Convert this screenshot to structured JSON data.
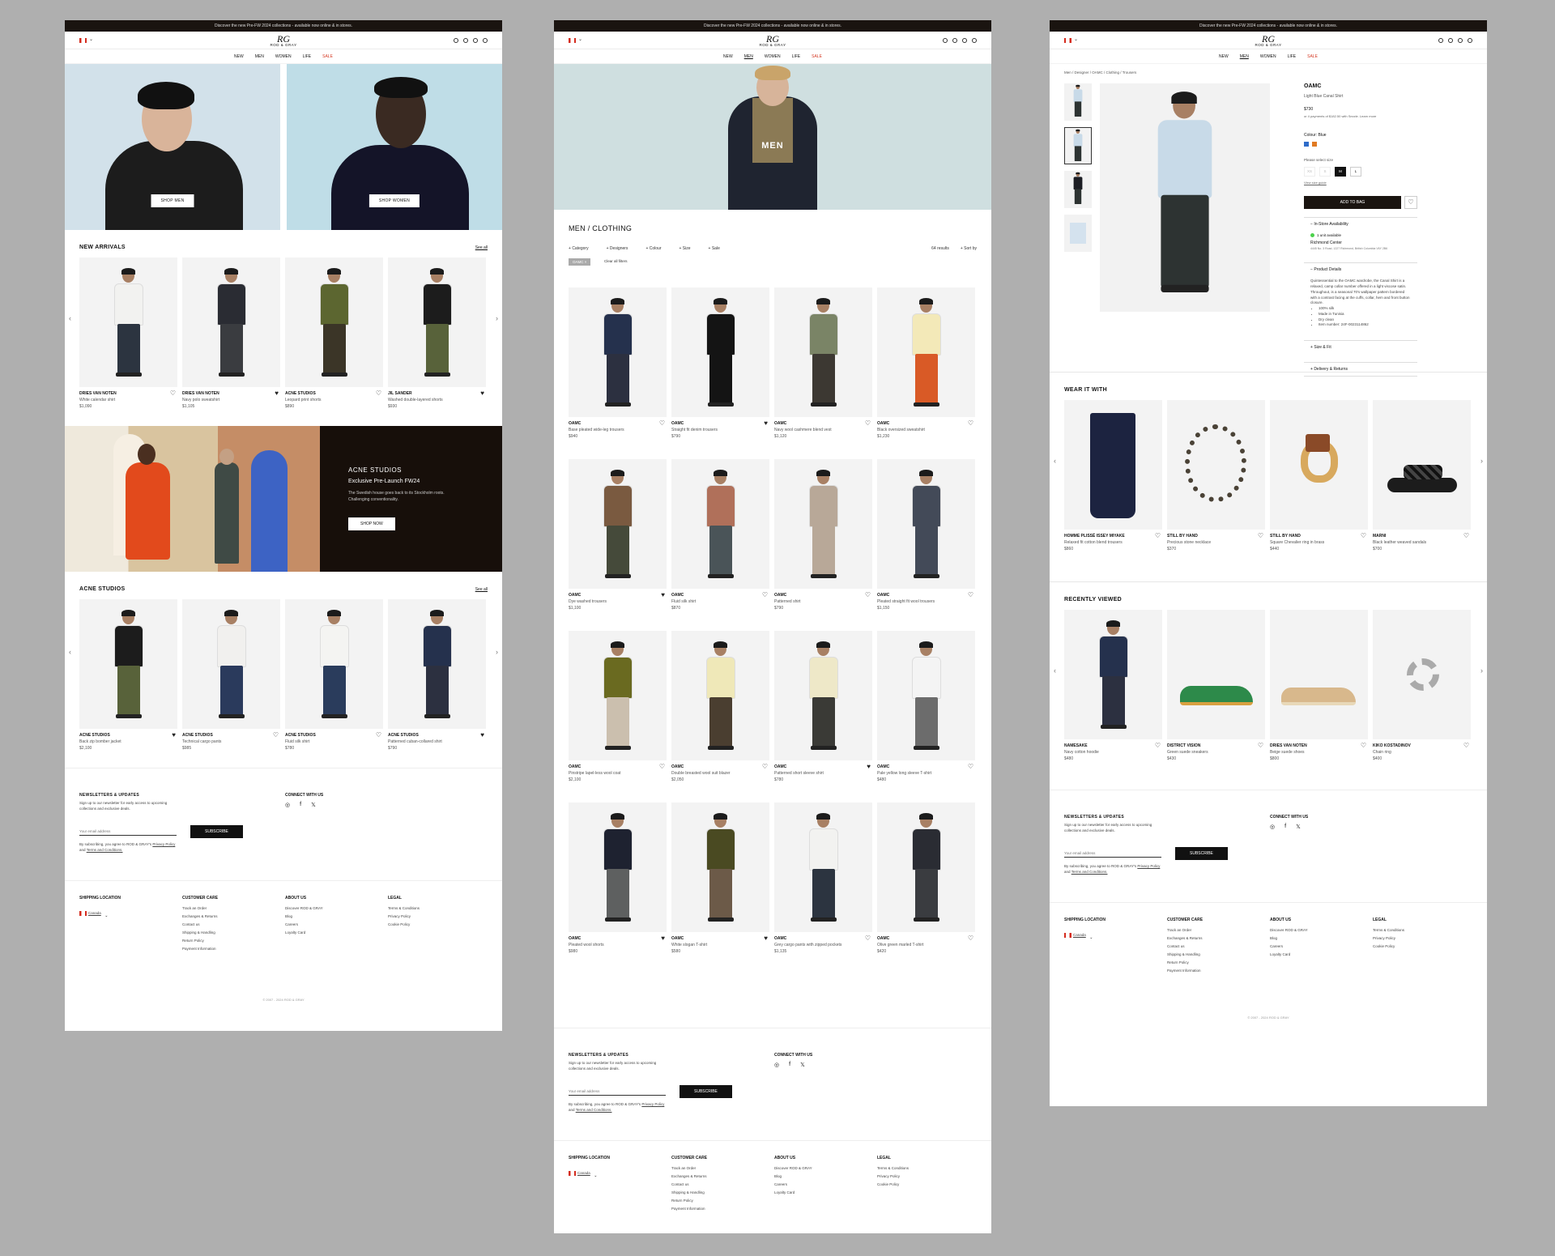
{
  "header": {
    "banner": "Discover the new Pre-FW 2024 collections - available now online & in stores.",
    "logo_mark": "RG",
    "logo_text": "ROD & GRAY",
    "nav": [
      "NEW",
      "MEN",
      "WOMEN",
      "LIFE",
      "SALE"
    ]
  },
  "home": {
    "hero": {
      "men_button": "SHOP MEN",
      "women_button": "SHOP WOMEN"
    },
    "new_arrivals": {
      "title": "NEW ARRIVALS",
      "see_all": "See all",
      "items": [
        {
          "brand": "DRIES VAN NOTEN",
          "desc": "White calendar shirt",
          "price": "$1,090",
          "fav": false
        },
        {
          "brand": "DRIES VAN NOTEN",
          "desc": "Navy polo sweatshirt",
          "price": "$1,105",
          "fav": true
        },
        {
          "brand": "ACNE STUDIOS",
          "desc": "Leopard print shorts",
          "price": "$890",
          "fav": false
        },
        {
          "brand": "JIL SANDER",
          "desc": "Washed double-layered shorts",
          "price": "$930",
          "fav": true
        }
      ]
    },
    "promo": {
      "brand": "ACNE STUDIOS",
      "title": "Exclusive Pre-Launch FW24",
      "desc": "The Swedish house goes back to its Stockholm roots. Challenging conventionality.",
      "button": "SHOP NOW"
    },
    "acne": {
      "title": "ACNE STUDIOS",
      "see_all": "See all",
      "items": [
        {
          "brand": "ACNE STUDIOS",
          "desc": "Back zip bomber jacket",
          "price": "$2,100",
          "fav": true
        },
        {
          "brand": "ACNE STUDIOS",
          "desc": "Technical cargo pants",
          "price": "$985",
          "fav": false
        },
        {
          "brand": "ACNE STUDIOS",
          "desc": "Fluid silk shirt",
          "price": "$780",
          "fav": false
        },
        {
          "brand": "ACNE STUDIOS",
          "desc": "Patterned cuban-collared shirt",
          "price": "$790",
          "fav": true
        }
      ]
    }
  },
  "plp": {
    "hero_title": "MEN",
    "title": "MEN / CLOTHING",
    "filters": [
      "Category",
      "Designers",
      "Colour",
      "Size",
      "Sale"
    ],
    "results": "64 results",
    "sort": "Sort by",
    "chip": "OAMC",
    "clear": "Clear all filters",
    "items": [
      {
        "brand": "OAMC",
        "desc": "Base pleated wide-leg trousers",
        "price": "$940",
        "fav": false
      },
      {
        "brand": "OAMC",
        "desc": "Straight fit denim trousers",
        "price": "$790",
        "fav": true
      },
      {
        "brand": "OAMC",
        "desc": "Navy wool cashmere blend vest",
        "price": "$1,120",
        "fav": false
      },
      {
        "brand": "OAMC",
        "desc": "Black oversized sweatshirt",
        "price": "$1,230",
        "fav": false
      },
      {
        "brand": "OAMC",
        "desc": "Dye washed trousers",
        "price": "$1,100",
        "fav": true
      },
      {
        "brand": "OAMC",
        "desc": "Fluid silk shirt",
        "price": "$870",
        "fav": false
      },
      {
        "brand": "OAMC",
        "desc": "Patterned shirt",
        "price": "$790",
        "fav": false
      },
      {
        "brand": "OAMC",
        "desc": "Pleated straight fit wool trousers",
        "price": "$1,150",
        "fav": false
      },
      {
        "brand": "OAMC",
        "desc": "Pinstripe lapel-less wool coat",
        "price": "$2,100",
        "fav": false
      },
      {
        "brand": "OAMC",
        "desc": "Double breasted wool suit blazer",
        "price": "$2,050",
        "fav": false
      },
      {
        "brand": "OAMC",
        "desc": "Patterned short sleeve shirt",
        "price": "$780",
        "fav": true
      },
      {
        "brand": "OAMC",
        "desc": "Pale yellow long sleeve T-shirt",
        "price": "$480",
        "fav": false
      },
      {
        "brand": "OAMC",
        "desc": "Pleated wool shorts",
        "price": "$980",
        "fav": true
      },
      {
        "brand": "OAMC",
        "desc": "White slogan T-shirt",
        "price": "$580",
        "fav": true
      },
      {
        "brand": "OAMC",
        "desc": "Grey cargo pants with zipped pockets",
        "price": "$1,135",
        "fav": false
      },
      {
        "brand": "OAMC",
        "desc": "Olive green marled T-shirt",
        "price": "$420",
        "fav": false
      }
    ]
  },
  "pdp": {
    "breadcrumb": "Men / Designer / OAMC / Clothing / Trousers",
    "brand": "OAMC",
    "name": "Light Blue Canal Shirt",
    "price": "$730",
    "installments": "or 4 payments of $182.50 with Sezzle. Learn more",
    "colour_label": "Colour: Blue",
    "size_label": "Please select size",
    "sizes": [
      "XS",
      "S",
      "M",
      "L"
    ],
    "size_guide": "View size guide",
    "add_to_bag": "ADD TO BAG",
    "availability": "In-Store Availability",
    "stock": "1 unit available",
    "store": "Richmond Center",
    "store_addr": "4445 No. 3 Road, 1227 Richmond, British Columbia V6Y 2B6",
    "details_title": "Product Details",
    "details": "Quintessential to the OAMC wardrobe, the Canal Shirt is a relaxed, camp collar number offered in a light viscose satin. Throughout, is a seasonal 70's wallpaper pattern bordered with a contrast facing at the cuffs, collar, hem and front button closure.",
    "bullets": [
      "100% silk",
      "Made in Tunisia",
      "Dry clean",
      "Item number: 24F-0023114862"
    ],
    "size_fit": "Size & Fit",
    "delivery": "Delivery & Returns",
    "colors": {
      "blue": "#2f6cc9",
      "orange": "#e07a22"
    },
    "wear_title": "WEAR IT WITH",
    "wear": [
      {
        "brand": "HOMME PLISSÉ ISSEY MIYAKE",
        "desc": "Relaxed fit cotton blend trousers",
        "price": "$860",
        "fav": false
      },
      {
        "brand": "STILL BY HAND",
        "desc": "Precious stone necklace",
        "price": "$370",
        "fav": false
      },
      {
        "brand": "STILL BY HAND",
        "desc": "Square Chevalier ring in brass",
        "price": "$440",
        "fav": false
      },
      {
        "brand": "MARNI",
        "desc": "Black leather weaved sandals",
        "price": "$700",
        "fav": false
      }
    ],
    "recent_title": "RECENTLY VIEWED",
    "recent": [
      {
        "brand": "NAMESAKE",
        "desc": "Navy cotton hoodie",
        "price": "$480",
        "fav": false
      },
      {
        "brand": "DISTRICT VISION",
        "desc": "Green suede sneakers",
        "price": "$430",
        "fav": false
      },
      {
        "brand": "DRIES VAN NOTEN",
        "desc": "Beige suede shoes",
        "price": "$800",
        "fav": false
      },
      {
        "brand": "KIKO KOSTADINOV",
        "desc": "Chain ring",
        "price": "$400",
        "fav": false
      }
    ]
  },
  "footer": {
    "news_title": "NEWSLETTERS & UPDATES",
    "news_desc": "Sign up to our newsletter for early access to upcoming collections and exclusive deals.",
    "email_placeholder": "Your email address",
    "subscribe": "SUBSCRIBE",
    "legal_pre": "By subscribing, you agree to ROD & GRAY's",
    "privacy": "Privacy Policy",
    "and": "and",
    "terms": "Terms and Conditions.",
    "connect": "CONNECT WITH US",
    "socials": [
      "◎",
      "f",
      "𝕏"
    ],
    "cols": [
      {
        "title": "SHIPPING LOCATION",
        "links": []
      },
      {
        "title": "CUSTOMER CARE",
        "links": [
          "Track an Order",
          "Exchanges & Returns",
          "Contact us",
          "Shipping & Handling",
          "Return Policy",
          "Payment Information"
        ]
      },
      {
        "title": "ABOUT US",
        "links": [
          "Discover ROD & GRAY",
          "Blog",
          "Careers",
          "Loyalty Card"
        ]
      },
      {
        "title": "LEGAL",
        "links": [
          "Terms & Conditions",
          "Privacy Policy",
          "Cookie Policy"
        ]
      }
    ],
    "country": "Canada",
    "copyright": "© 2007 - 2024 ROD & GRAY"
  }
}
